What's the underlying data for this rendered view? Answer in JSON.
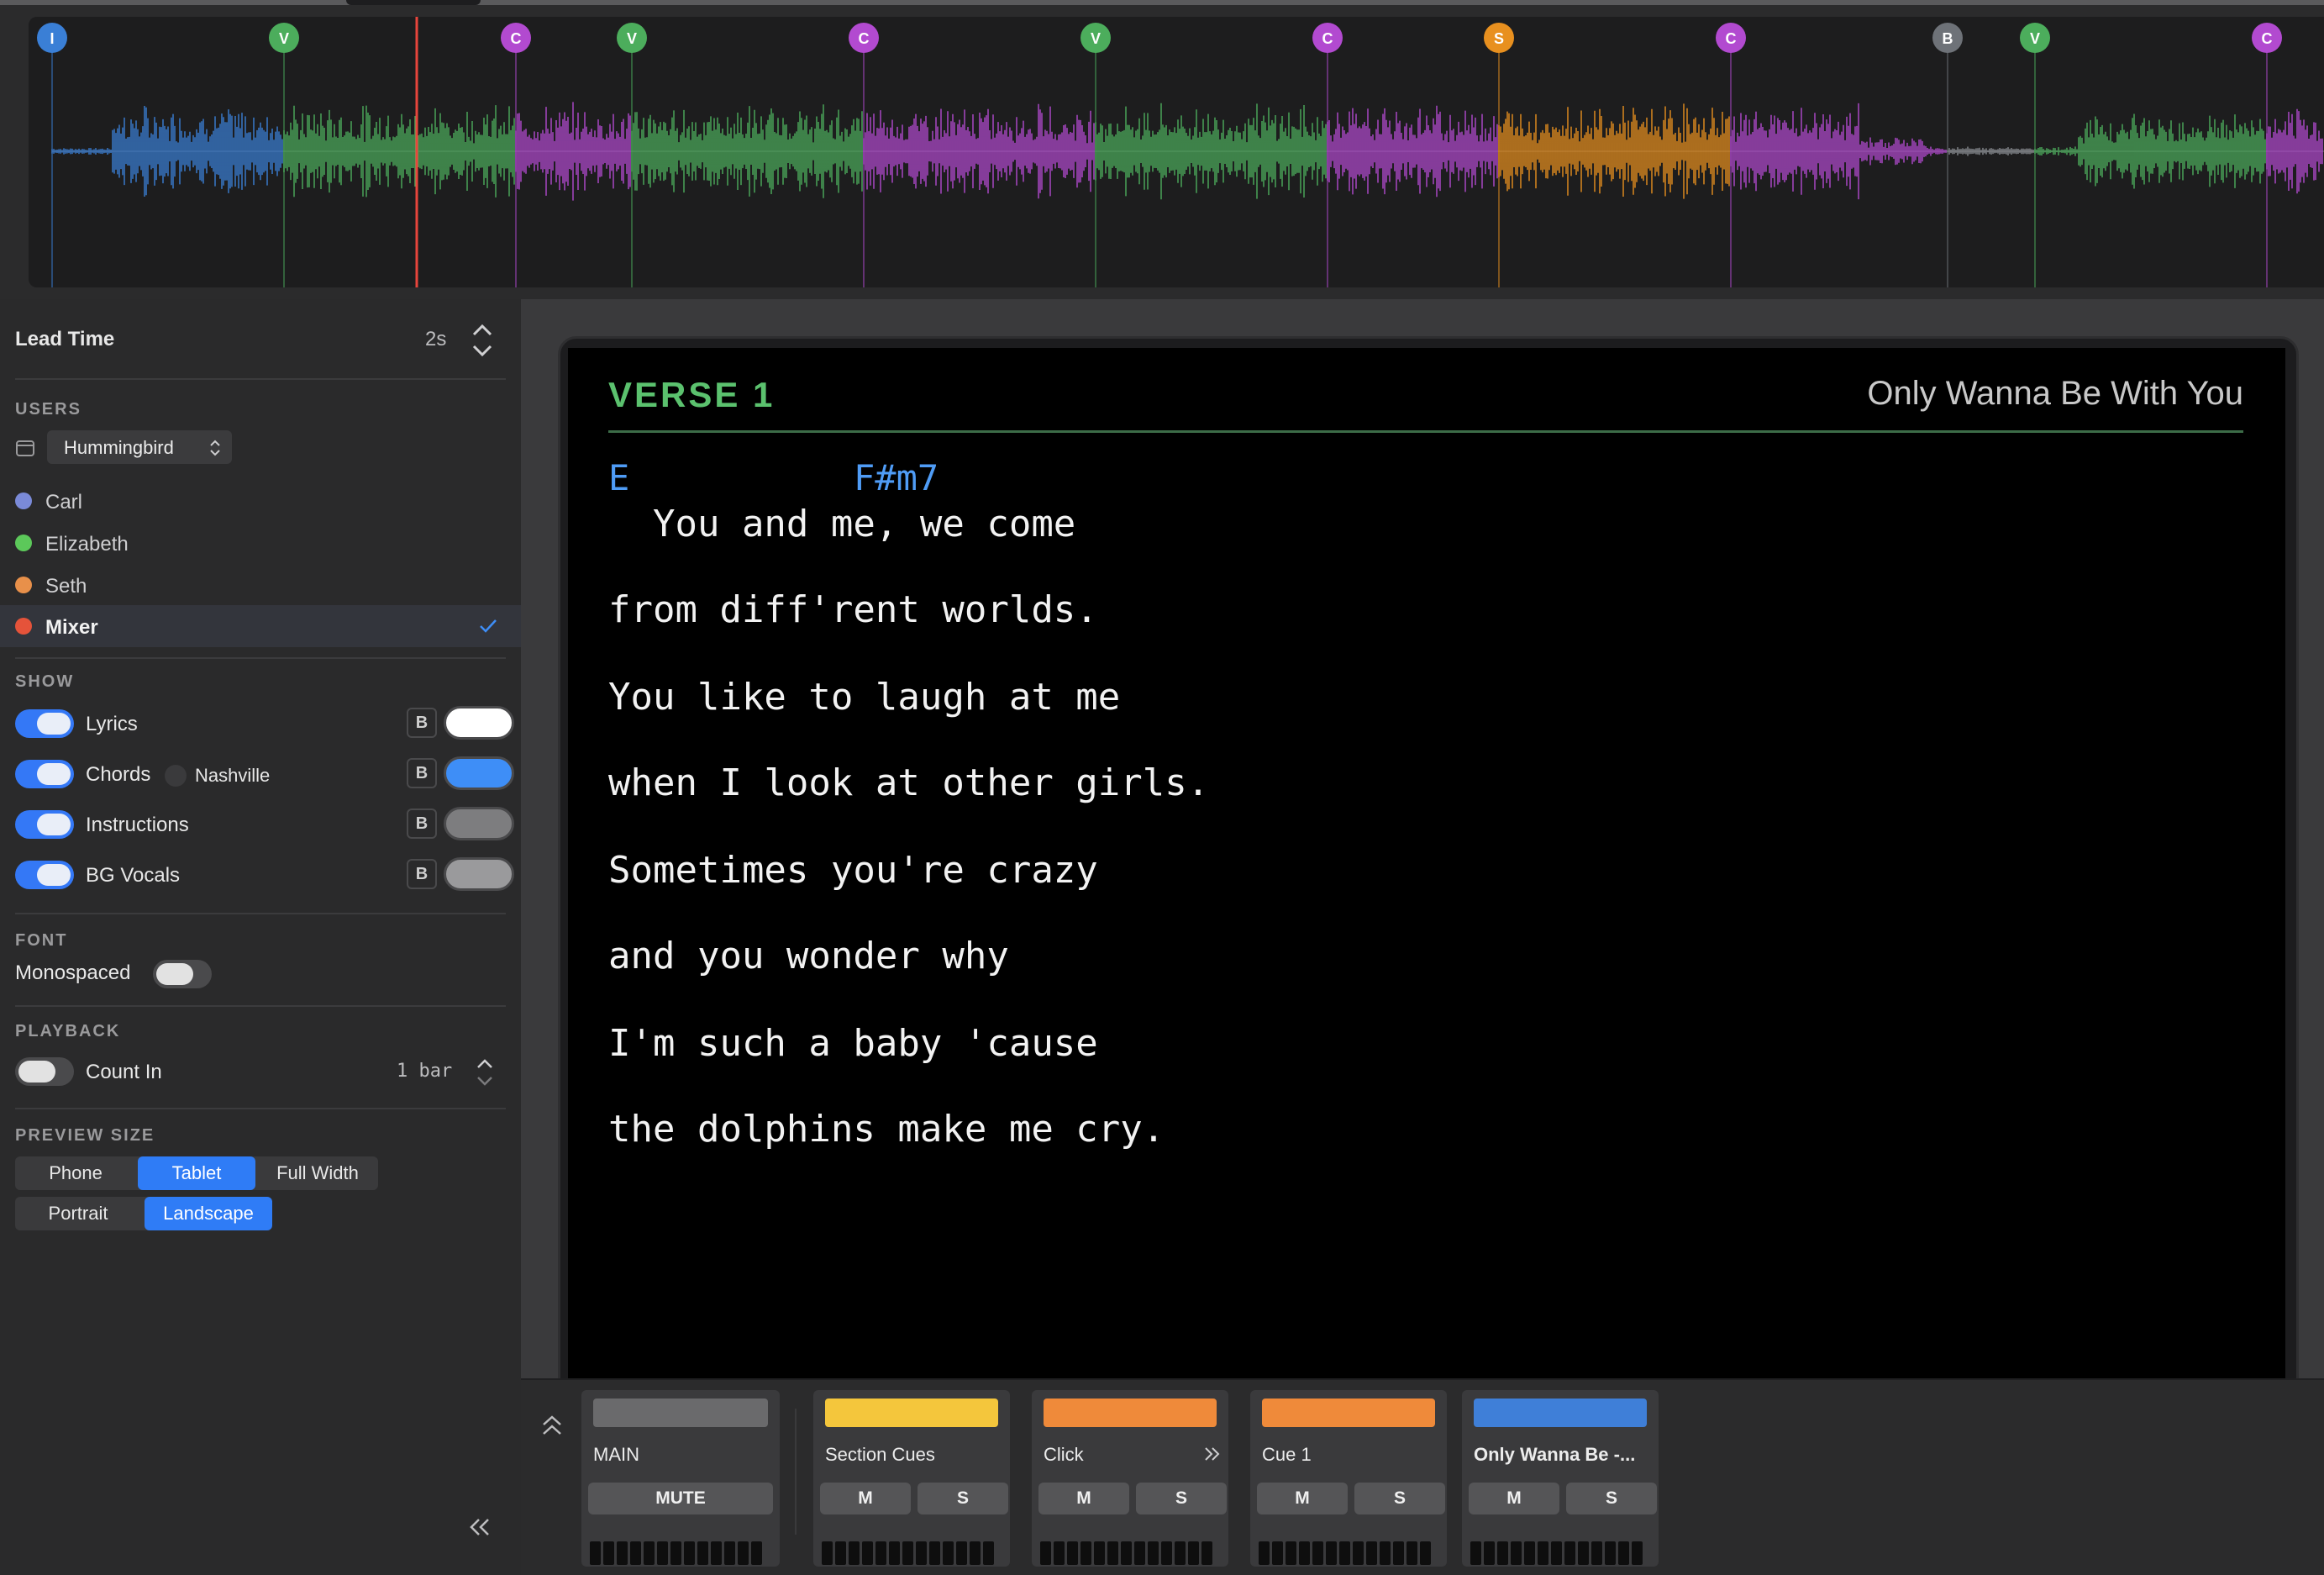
{
  "timeline": {
    "markers": [
      {
        "letter": "I",
        "color": "#3a7fd6"
      },
      {
        "letter": "V",
        "color": "#4cad5c"
      },
      {
        "letter": "C",
        "color": "#b24ad0"
      },
      {
        "letter": "V",
        "color": "#4cad5c"
      },
      {
        "letter": "C",
        "color": "#b24ad0"
      },
      {
        "letter": "V",
        "color": "#4cad5c"
      },
      {
        "letter": "C",
        "color": "#b24ad0"
      },
      {
        "letter": "S",
        "color": "#e8901f"
      },
      {
        "letter": "C",
        "color": "#b24ad0"
      },
      {
        "letter": "B",
        "color": "#6e7278"
      },
      {
        "letter": "V",
        "color": "#4cad5c"
      },
      {
        "letter": "C",
        "color": "#b24ad0"
      }
    ],
    "playhead_color": "#e8453c"
  },
  "sidebar": {
    "lead_time": {
      "label": "Lead Time",
      "value": "2s"
    },
    "users": {
      "heading": "USERS",
      "selected_user": "Hummingbird",
      "items": [
        {
          "name": "Carl",
          "color": "#7a8ad8"
        },
        {
          "name": "Elizabeth",
          "color": "#5cc85a"
        },
        {
          "name": "Seth",
          "color": "#e8904a"
        },
        {
          "name": "Mixer",
          "color": "#e5533a"
        }
      ]
    },
    "show": {
      "heading": "SHOW",
      "items": [
        {
          "label": "Lyrics",
          "b": "B",
          "swatch": "#ffffff"
        },
        {
          "label": "Chords",
          "b": "B",
          "swatch": "#3e8ef7",
          "extra": "Nashville"
        },
        {
          "label": "Instructions",
          "b": "B",
          "swatch": "#7d7d7f"
        },
        {
          "label": "BG Vocals",
          "b": "B",
          "swatch": "#9a9a9c"
        }
      ]
    },
    "font": {
      "heading": "FONT",
      "monospaced_label": "Monospaced"
    },
    "playback": {
      "heading": "PLAYBACK",
      "count_in_label": "Count In",
      "count_in_value": "1 bar"
    },
    "preview_size": {
      "heading": "PREVIEW SIZE",
      "devices": [
        "Phone",
        "Tablet",
        "Full Width"
      ],
      "active_device": "Tablet",
      "orientations": [
        "Portrait",
        "Landscape"
      ],
      "active_orientation": "Landscape"
    }
  },
  "preview": {
    "section_title": "VERSE 1",
    "song_title": "Only Wanna Be With You",
    "chords": [
      "E",
      "F#m7"
    ],
    "lines": [
      "  You and me, we come",
      "from diff'rent worlds.",
      "You like to laugh at me",
      "when I look at other girls.",
      "Sometimes you're crazy",
      "and you wonder why",
      "I'm such a baby 'cause",
      "the dolphins make me cry."
    ]
  },
  "mixer": {
    "channels": [
      {
        "name": "MAIN",
        "color": "#6a6a6c",
        "buttons": [
          "MUTE"
        ]
      },
      {
        "name": "Section Cues",
        "color": "#f4c63c",
        "buttons": [
          "M",
          "S"
        ]
      },
      {
        "name": "Click",
        "color": "#ef8a3a",
        "buttons": [
          "M",
          "S"
        ]
      },
      {
        "name": "Cue 1",
        "color": "#ef8a3a",
        "buttons": [
          "M",
          "S"
        ]
      },
      {
        "name": "Only Wanna Be -...",
        "color": "#3f7fd8",
        "buttons": [
          "M",
          "S"
        ]
      }
    ]
  }
}
